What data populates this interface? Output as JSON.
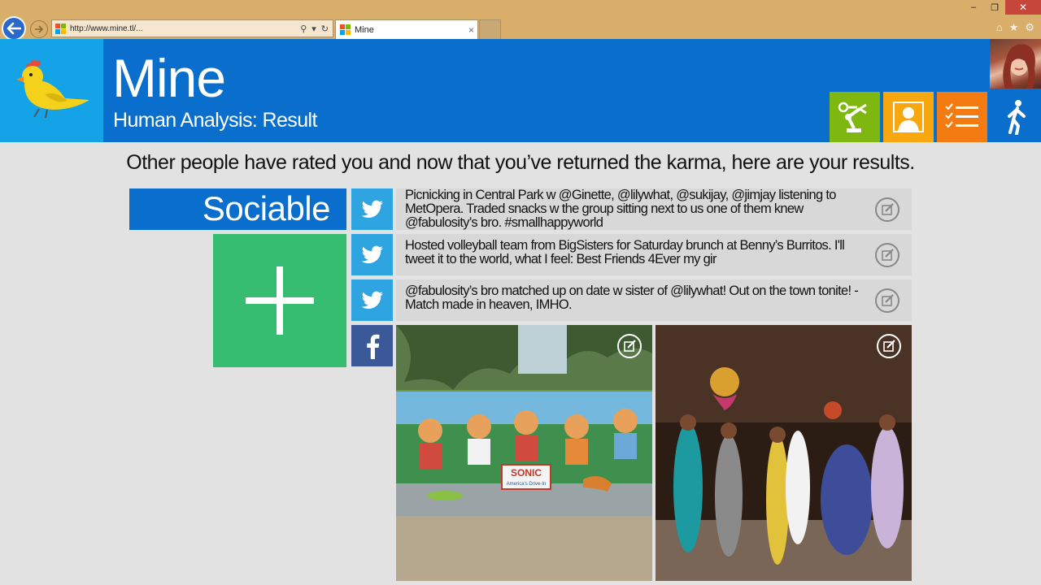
{
  "browser": {
    "url": "http://www.mine.tl/...",
    "tab_title": "Mine",
    "tab_close": "×",
    "window_buttons": {
      "minimize": "‒",
      "restore": "❐",
      "close": "✕"
    },
    "toolbar_icons": [
      "home-icon",
      "favorites-icon",
      "settings-icon"
    ]
  },
  "app": {
    "title": "Mine",
    "subtitle": "Human Analysis: Result",
    "nav_tiles": [
      {
        "name": "robot-arm",
        "color": "#7db710"
      },
      {
        "name": "person",
        "color": "#f8a70f"
      },
      {
        "name": "checklist",
        "color": "#f47a12"
      },
      {
        "name": "walking-person",
        "color": "#0a6fcc"
      }
    ]
  },
  "main": {
    "intro": "Other people have rated you and now that you’ve returned the karma, here are your results.",
    "category": "Sociable",
    "posts": [
      {
        "source": "twitter",
        "text": "Picnicking in Central Park w @Ginette, @lilywhat, @sukijay, @jimjay listening to MetOpera. Traded snacks w the group sitting next to us one of them knew @fabulosity’s bro.  #smallhappyworld"
      },
      {
        "source": "twitter",
        "text": "Hosted volleyball team from BigSisters for Saturday brunch at Benny’s Burritos. I'll tweet it to the world, what I feel:  Best Friends 4Ever my gir"
      },
      {
        "source": "twitter",
        "text": "@fabulosity’s bro matched up on date w sister of @lilywhat!   Out on the town tonite! - Match made in heaven, IMHO."
      }
    ],
    "photos_source": "facebook",
    "photo_sign": {
      "brand": "SONIC",
      "tagline": "America's Drive-In"
    }
  },
  "colors": {
    "header_blue": "#0a6fcc",
    "logo_cyan": "#13a3e6",
    "add_green": "#37bd72",
    "twitter": "#2ea5e0",
    "facebook": "#3b5998"
  }
}
